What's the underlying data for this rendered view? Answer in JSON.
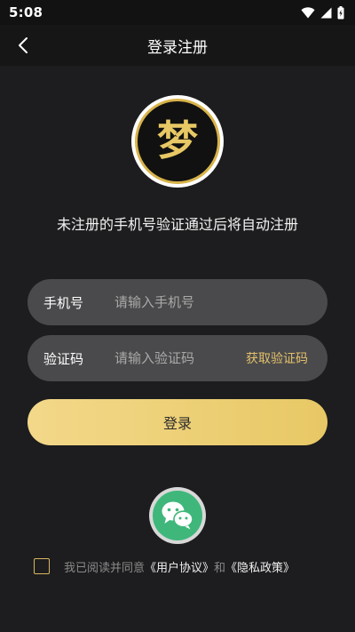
{
  "status_bar": {
    "time": "5:08",
    "icons": [
      "wifi-icon",
      "cellular-signal-icon",
      "battery-icon"
    ]
  },
  "app_bar": {
    "back_icon": "chevron-left-icon",
    "title": "登录注册"
  },
  "logo": {
    "glyph": "梦",
    "ring_color": "#d8b34a"
  },
  "tagline": "未注册的手机号验证通过后将自动注册",
  "phone_field": {
    "label": "手机号",
    "placeholder": "请输入手机号",
    "value": ""
  },
  "code_field": {
    "label": "验证码",
    "placeholder": "请输入验证码",
    "value": "",
    "get_code_label": "获取验证码"
  },
  "login_button": {
    "label": "登录"
  },
  "wechat_login": {
    "icon": "wechat-icon",
    "color": "#3fb77b"
  },
  "agreement": {
    "checked": false,
    "prefix": "我已阅读并同意",
    "user_agreement": "《用户协议》",
    "conjunction": "和",
    "privacy_policy": "《隐私政策》"
  },
  "colors": {
    "background": "#1d1d1f",
    "field_bg": "#4a4a4c",
    "accent_gold": "#e2c06b",
    "button_gradient_start": "#f3d88a",
    "button_gradient_end": "#e8c865"
  }
}
